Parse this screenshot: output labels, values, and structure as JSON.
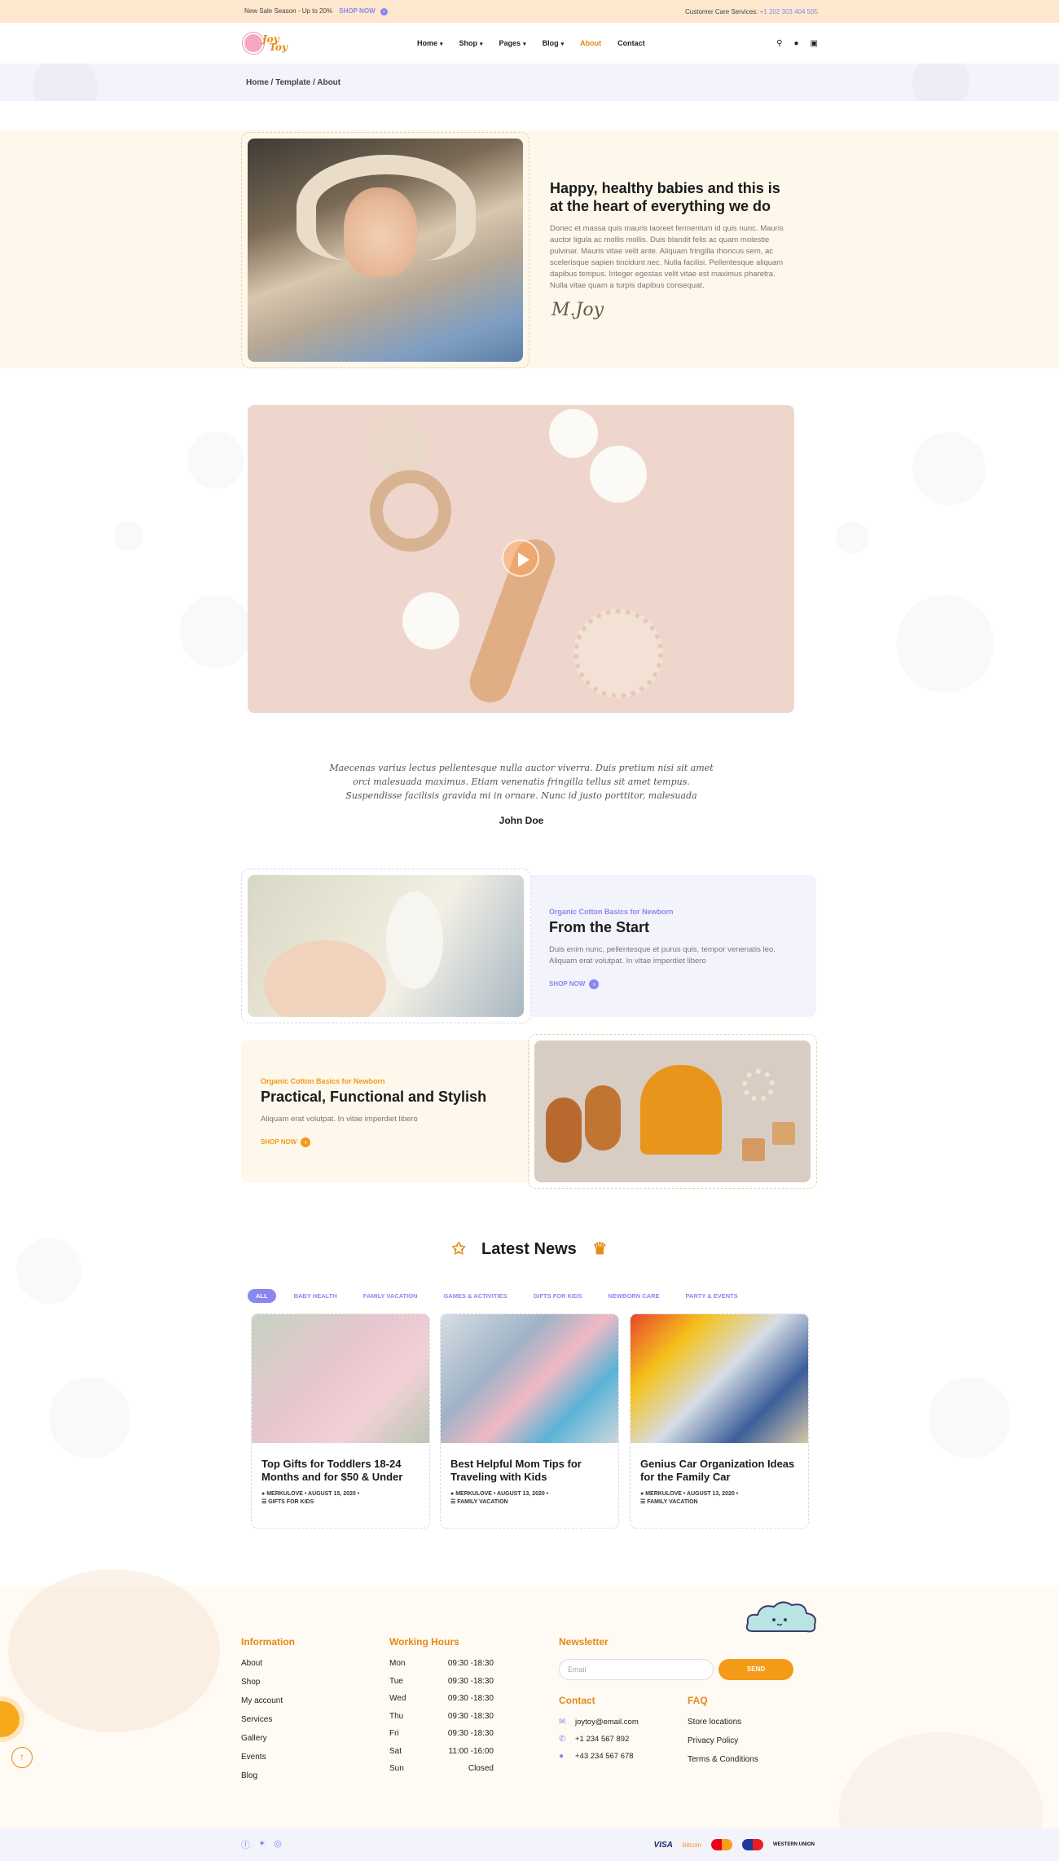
{
  "topbar": {
    "promo_text": "New Sale Season - Up to 20%",
    "shop_now": "SHOP NOW",
    "care_label": "Customer Care Services:",
    "care_phone": "+1 202 303 404 505"
  },
  "header": {
    "logo_line1": "Joy",
    "logo_line2": "Toy",
    "nav": [
      {
        "label": "Home",
        "has_dropdown": true
      },
      {
        "label": "Shop",
        "has_dropdown": true
      },
      {
        "label": "Pages",
        "has_dropdown": true
      },
      {
        "label": "Blog",
        "has_dropdown": true
      },
      {
        "label": "About",
        "active": true
      },
      {
        "label": "Contact"
      }
    ],
    "icons": [
      "search-icon",
      "user-icon",
      "bag-icon"
    ]
  },
  "breadcrumb": "Home / Template / About",
  "about": {
    "title": "Happy, healthy babies and this is at the heart of everything we do",
    "body": "Donec et massa quis mauris laoreet fermentum id quis nunc. Mauris auctor ligula ac mollis mollis. Duis blandit felis ac quam molestie pulvinar. Mauris vitae velit ante. Aliquam fringilla rhoncus sem, ac scelerisque sapien tincidunt nec. Nulla facilisi. Pellentesque aliquam dapibus tempus. Integer egestas velit vitae est maximus pharetra. Nulla vitae quam a turpis dapibus consequat.",
    "signature": "M.Joy"
  },
  "quote": {
    "text": "Maecenas varius lectus pellentesque nulla auctor viverra. Duis pretium nisi sit amet orci malesuada maximus. Etiam venenatis fringilla tellus sit amet tempus. Suspendisse facilisis gravida mi in ornare. Nunc id justo porttitor, malesuada",
    "author": "John Doe"
  },
  "promo1": {
    "subtitle": "Organic Cotton Basics for Newborn",
    "title": "From the Start",
    "desc": "Duis enim nunc, pellentesque et purus quis, tempor venenatis leo. Aliquam erat volutpat. In vitae imperdiet libero",
    "button": "SHOP NOW",
    "accent": "#8a87f0"
  },
  "promo2": {
    "subtitle": "Organic Cotton Basics for Newborn",
    "title": "Practical, Functional and Stylish",
    "desc": "Aliquam erat volutpat. In vitae imperdiet libero",
    "button": "SHOP NOW",
    "accent": "#f39a17"
  },
  "news": {
    "title": "Latest News",
    "filters": [
      "ALL",
      "BABY HEALTH",
      "FAMILY VACATION",
      "GAMES & ACTIVITIES",
      "GIFTS FOR KIDS",
      "NEWBORN CARE",
      "PARTY & EVENTS"
    ],
    "posts": [
      {
        "title": "Top Gifts for Toddlers 18-24 Months and for $50 & Under",
        "author": "MERKULOVE",
        "date": "AUGUST 15, 2020",
        "category": "GIFTS FOR KIDS"
      },
      {
        "title": "Best Helpful Mom Tips for Traveling with Kids",
        "author": "MERKULOVE",
        "date": "AUGUST 13, 2020",
        "category": "FAMILY VACATION"
      },
      {
        "title": "Genius Car Organization Ideas for the Family Car",
        "author": "MERKULOVE",
        "date": "AUGUST 13, 2020",
        "category": "FAMILY VACATION"
      }
    ]
  },
  "footer": {
    "information": {
      "title": "Information",
      "links": [
        "About",
        "Shop",
        "My account",
        "Services",
        "Gallery",
        "Events",
        "Blog"
      ]
    },
    "hours": {
      "title": "Working Hours",
      "rows": [
        {
          "day": "Mon",
          "time": "09:30 -18:30"
        },
        {
          "day": "Tue",
          "time": "09:30 -18:30"
        },
        {
          "day": "Wed",
          "time": "09:30 -18:30"
        },
        {
          "day": "Thu",
          "time": "09:30 -18:30"
        },
        {
          "day": "Fri",
          "time": "09:30 -18:30"
        },
        {
          "day": "Sat",
          "time": "11:00 -16:00"
        },
        {
          "day": "Sun",
          "time": "Closed"
        }
      ]
    },
    "newsletter": {
      "title": "Newsletter",
      "placeholder": "Email",
      "button": "SEND"
    },
    "contact": {
      "title": "Contact",
      "email": "joytoy@email.com",
      "phone": "+1 234 567 892",
      "whatsapp": "+43 234 567 678"
    },
    "faq": {
      "title": "FAQ",
      "links": [
        "Store locations",
        "Privacy Policy",
        "Terms & Conditions"
      ]
    }
  },
  "bottom": {
    "social": [
      "facebook-icon",
      "twitter-icon",
      "instagram-icon"
    ],
    "payments": [
      "VISA",
      "bitcoin",
      "mastercard",
      "maestro",
      "western union"
    ]
  },
  "colors": {
    "accent_purple": "#8a87f0",
    "accent_orange": "#e58a14",
    "cream": "#fef7ec",
    "lavender": "#f3f3fc"
  }
}
